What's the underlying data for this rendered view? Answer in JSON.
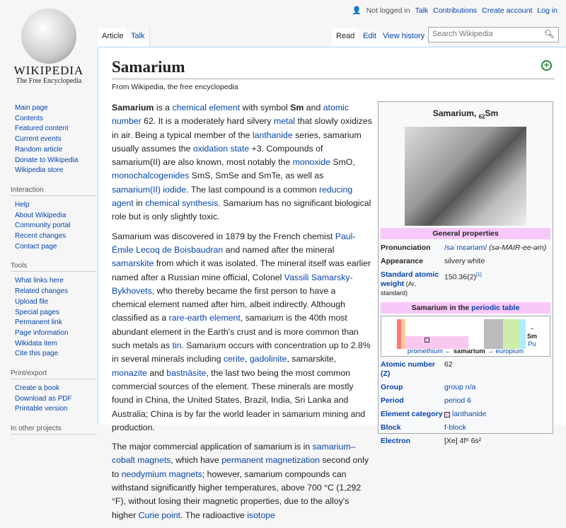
{
  "logo": {
    "wordmark": "Wikipedia",
    "tagline": "The Free Encyclopedia"
  },
  "personal": {
    "status": "Not logged in",
    "links": [
      "Talk",
      "Contributions",
      "Create account",
      "Log in"
    ]
  },
  "tabs": {
    "article": "Article",
    "talk": "Talk",
    "read": "Read",
    "edit": "Edit",
    "history": "View history"
  },
  "search": {
    "placeholder": "Search Wikipedia"
  },
  "sidebar": {
    "nav": [
      "Main page",
      "Contents",
      "Featured content",
      "Current events",
      "Random article",
      "Donate to Wikipedia",
      "Wikipedia store"
    ],
    "interaction": {
      "title": "Interaction",
      "items": [
        "Help",
        "About Wikipedia",
        "Community portal",
        "Recent changes",
        "Contact page"
      ]
    },
    "tools": {
      "title": "Tools",
      "items": [
        "What links here",
        "Related changes",
        "Upload file",
        "Special pages",
        "Permanent link",
        "Page information",
        "Wikidata item",
        "Cite this page"
      ]
    },
    "print": {
      "title": "Print/export",
      "items": [
        "Create a book",
        "Download as PDF",
        "Printable version"
      ]
    },
    "other": {
      "title": "In other projects"
    }
  },
  "page": {
    "title": "Samarium",
    "from": "From Wikipedia, the free encyclopedia"
  },
  "paragraphs": [
    [
      [
        "Samarium",
        2
      ],
      [
        " is a ",
        0
      ],
      [
        "chemical element",
        1
      ],
      [
        " with symbol ",
        0
      ],
      [
        "Sm",
        2
      ],
      [
        " and ",
        0
      ],
      [
        "atomic number",
        1
      ],
      [
        " 62. It is a moderately hard silvery ",
        0
      ],
      [
        "metal",
        1
      ],
      [
        " that slowly oxidizes in air. Being a typical member of the ",
        0
      ],
      [
        "lanthanide",
        1
      ],
      [
        " series, samarium usually assumes the ",
        0
      ],
      [
        "oxidation state",
        1
      ],
      [
        " +3. Compounds of samarium(II) are also known, most notably the ",
        0
      ],
      [
        "monoxide",
        1
      ],
      [
        " SmO, ",
        0
      ],
      [
        "monochalcogenides",
        1
      ],
      [
        " SmS, SmSe and SmTe, as well as ",
        0
      ],
      [
        "samarium(II) iodide",
        1
      ],
      [
        ". The last compound is a common ",
        0
      ],
      [
        "reducing agent",
        1
      ],
      [
        " in ",
        0
      ],
      [
        "chemical synthesis",
        1
      ],
      [
        ". Samarium has no significant biological role but is only slightly toxic.",
        0
      ]
    ],
    [
      [
        "Samarium was discovered in 1879 by the French chemist ",
        0
      ],
      [
        "Paul-Émile Lecoq de Boisbaudran",
        1
      ],
      [
        " and named after the mineral ",
        0
      ],
      [
        "samarskite",
        1
      ],
      [
        " from which it was isolated. The mineral itself was earlier named after a Russian mine official, Colonel ",
        0
      ],
      [
        "Vassili Samarsky-Bykhovets",
        1
      ],
      [
        ", who thereby became the first person to have a chemical element named after him, albeit indirectly. Although classified as a ",
        0
      ],
      [
        "rare-earth element",
        1
      ],
      [
        ", samarium is the 40th most abundant element in the Earth's crust and is more common than such metals as ",
        0
      ],
      [
        "tin",
        1
      ],
      [
        ". Samarium occurs with concentration up to 2.8% in several minerals including ",
        0
      ],
      [
        "cerite",
        1
      ],
      [
        ", ",
        0
      ],
      [
        "gadolinite",
        1
      ],
      [
        ", samarskite, ",
        0
      ],
      [
        "monazite",
        1
      ],
      [
        " and ",
        0
      ],
      [
        "bastnäsite",
        1
      ],
      [
        ", the last two being the most common commercial sources of the element. These minerals are mostly found in China, the United States, Brazil, India, Sri Lanka and Australia; China is by far the world leader in samarium mining and production.",
        0
      ]
    ],
    [
      [
        "The major commercial application of samarium is in ",
        0
      ],
      [
        "samarium–cobalt magnets",
        1
      ],
      [
        ", which have ",
        0
      ],
      [
        "permanent magnetization",
        1
      ],
      [
        " second only to ",
        0
      ],
      [
        "neodymium magnets",
        1
      ],
      [
        "; however, samarium compounds can withstand significantly higher temperatures, above 700 °C (1,292 °F), without losing their magnetic properties, due to the alloy's higher ",
        0
      ],
      [
        "Curie point",
        1
      ],
      [
        ". The radioactive ",
        0
      ],
      [
        "isotope",
        1
      ]
    ]
  ],
  "infobox": {
    "title": "Samarium, ",
    "sub": "62",
    "sym": "Sm",
    "general": "General properties",
    "pron_k": "Pronunciation",
    "pron_v": "/səˈmɛəriəm/",
    "pron_r": " (sə-MAIR-ee-əm)",
    "app_k": "Appearance",
    "app_v": "silvery white",
    "saw_k": "Standard atomic weight",
    "saw_sub": " (Ar, standard)",
    "saw_v": "150.36(2)",
    "saw_ref": "[1]",
    "pt_hdr": "Samarium in the ",
    "pt_link": "periodic table",
    "pt_prev": "promethium",
    "pt_cur": "samarium",
    "pt_next": "europium",
    "pt_up": "–",
    "pt_sm": "Sm",
    "pt_down": "Pu",
    "rows": [
      [
        "Atomic number (Z)",
        "62",
        false
      ],
      [
        "Group",
        "group n/a",
        true
      ],
      [
        "Period",
        "period 6",
        true
      ],
      [
        "Element category",
        "lanthanide",
        true
      ],
      [
        "Block",
        "f-block",
        true
      ],
      [
        "Electron",
        "[Xe] 4f⁶ 6s²",
        false
      ]
    ]
  }
}
